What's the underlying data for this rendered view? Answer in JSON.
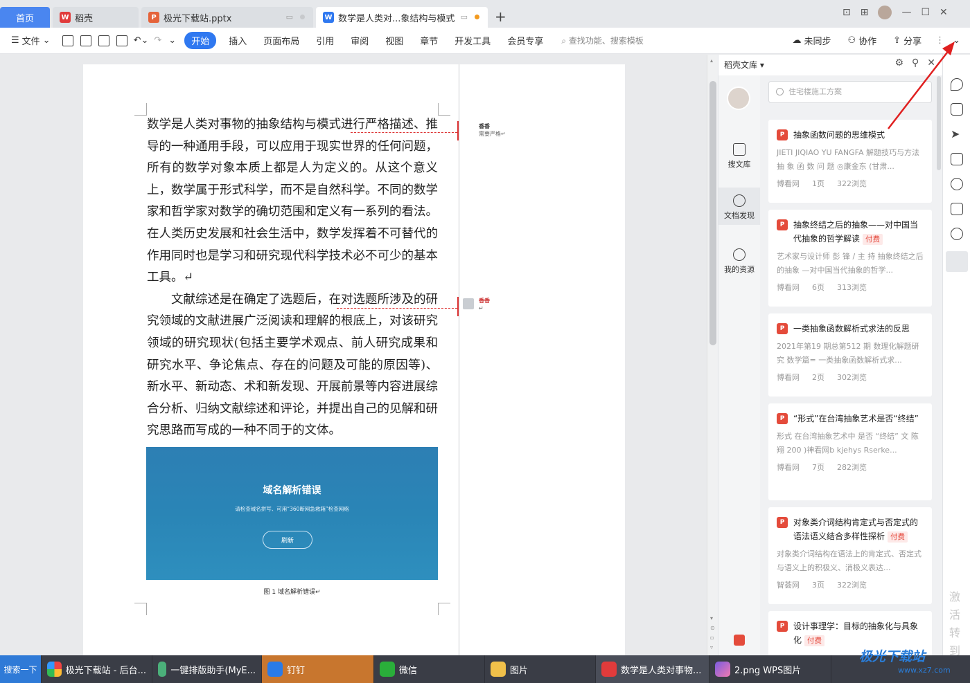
{
  "tabs": {
    "home": "首页",
    "t1": "稻壳",
    "t2": "极光下载站.pptx",
    "t3": "数学是人类对...象结构与模式"
  },
  "toolbar": {
    "file": "文件",
    "menus": [
      "开始",
      "插入",
      "页面布局",
      "引用",
      "审阅",
      "视图",
      "章节",
      "开发工具",
      "会员专享"
    ],
    "search_fn": "查找功能、搜索模板",
    "sync": "未同步",
    "collab": "协作",
    "share": "分享"
  },
  "document": {
    "para1": "数学是人类对事物的抽象结构与模式进行严格描述、推导的一种通用手段，可以应用于现实世界的任何问题，所有的数学对象本质上都是人为定义的。从这个意义上，数学属于形式科学，而不是自然科学。不同的数学家和哲学家对数学的确切范围和定义有一系列的看法。在人类历史发展和社会生活中，数学发挥着不可替代的作用同时也是学习和研究现代科学技术必不可少的基本工具。↵",
    "para2": "文献综述是在确定了选题后，在对选题所涉及的研究领域的文献进展广泛阅读和理解的根底上，对该研究领域的研究现状(包括主要学术观点、前人研究成果和研究水平、争论焦点、存在的问题及可能的原因等)、新水平、新动态、术和新发现、开展前景等内容进展综合分析、归纳文献综述和评论，并提出自己的见解和研究思路而写成的一种不同于的文体。",
    "comment1_name": "香香",
    "comment1_text": "需要严格↵",
    "comment2_name": "香香",
    "comment2_text": "↵",
    "figure_title": "域名解析错误",
    "figure_sub": "请检查域名拼写、可用“360断网急救箱”检查网络",
    "figure_button": "刷新",
    "caption": "图 1 域名解析错误↵"
  },
  "library": {
    "header": "稻壳文库",
    "search_placeholder": "住宅楼施工方案",
    "nav": [
      "搜文库",
      "文档发现",
      "我的资源"
    ],
    "cards": [
      {
        "title": "抽象函数问题的思维模式",
        "paid": "",
        "desc": "JIETI JIQIAO YU FANGFA 解题技巧与方法 抽 象 函 数 问 题 ◎康金东 (甘肃...",
        "source": "博看网",
        "pages": "1页",
        "views": "322浏览"
      },
      {
        "title": "抽象终结之后的抽象——对中国当代抽象的哲学解读",
        "paid": "付费",
        "desc": "艺术家与设计师 彭 锋 / 主 持 抽象终结之后的抽象 —对中国当代抽象的哲学...",
        "source": "博看网",
        "pages": "6页",
        "views": "313浏览"
      },
      {
        "title": "一类抽象函数解析式求法的反思",
        "paid": "",
        "desc": "2021年第19 期总第512 期 数理化解题研究 数学篇= 一类抽象函数解析式求...",
        "source": "博看网",
        "pages": "2页",
        "views": "302浏览"
      },
      {
        "title": "“形式”在台湾抽象艺术是否“终结”",
        "paid": "",
        "desc": "形式 在台湾抽象艺术中 是否 “终结” 文 陈 翔 200 )神看网b kjehys Rserke...",
        "source": "博看网",
        "pages": "7页",
        "views": "282浏览"
      },
      {
        "title": "对象类介词结构肯定式与否定式的语法语义结合多样性探析",
        "paid": "付费",
        "desc": "对象类介词结构在语法上的肯定式、否定式与语义上的积极义、消极义表达...",
        "source": "智荟网",
        "pages": "3页",
        "views": "322浏览"
      },
      {
        "title": "设计事理学：目标的抽象化与具象化",
        "paid": "付费",
        "desc": "",
        "source": "",
        "pages": "",
        "views": ""
      }
    ]
  },
  "right_watermark": "激活\n转到",
  "taskbar": {
    "search": "搜索一下",
    "items": [
      "极光下载站 - 后台...",
      "一键排版助手(MyE...",
      "钉钉",
      "微信",
      "图片",
      "数学是人类对事物...",
      "2.png  WPS图片"
    ]
  },
  "brand": {
    "name": "极光下载站",
    "url": "www.xz7.com"
  },
  "colors": {
    "accent": "#2f78f0",
    "paid": "#e4473a",
    "annotation": "#e02020"
  }
}
